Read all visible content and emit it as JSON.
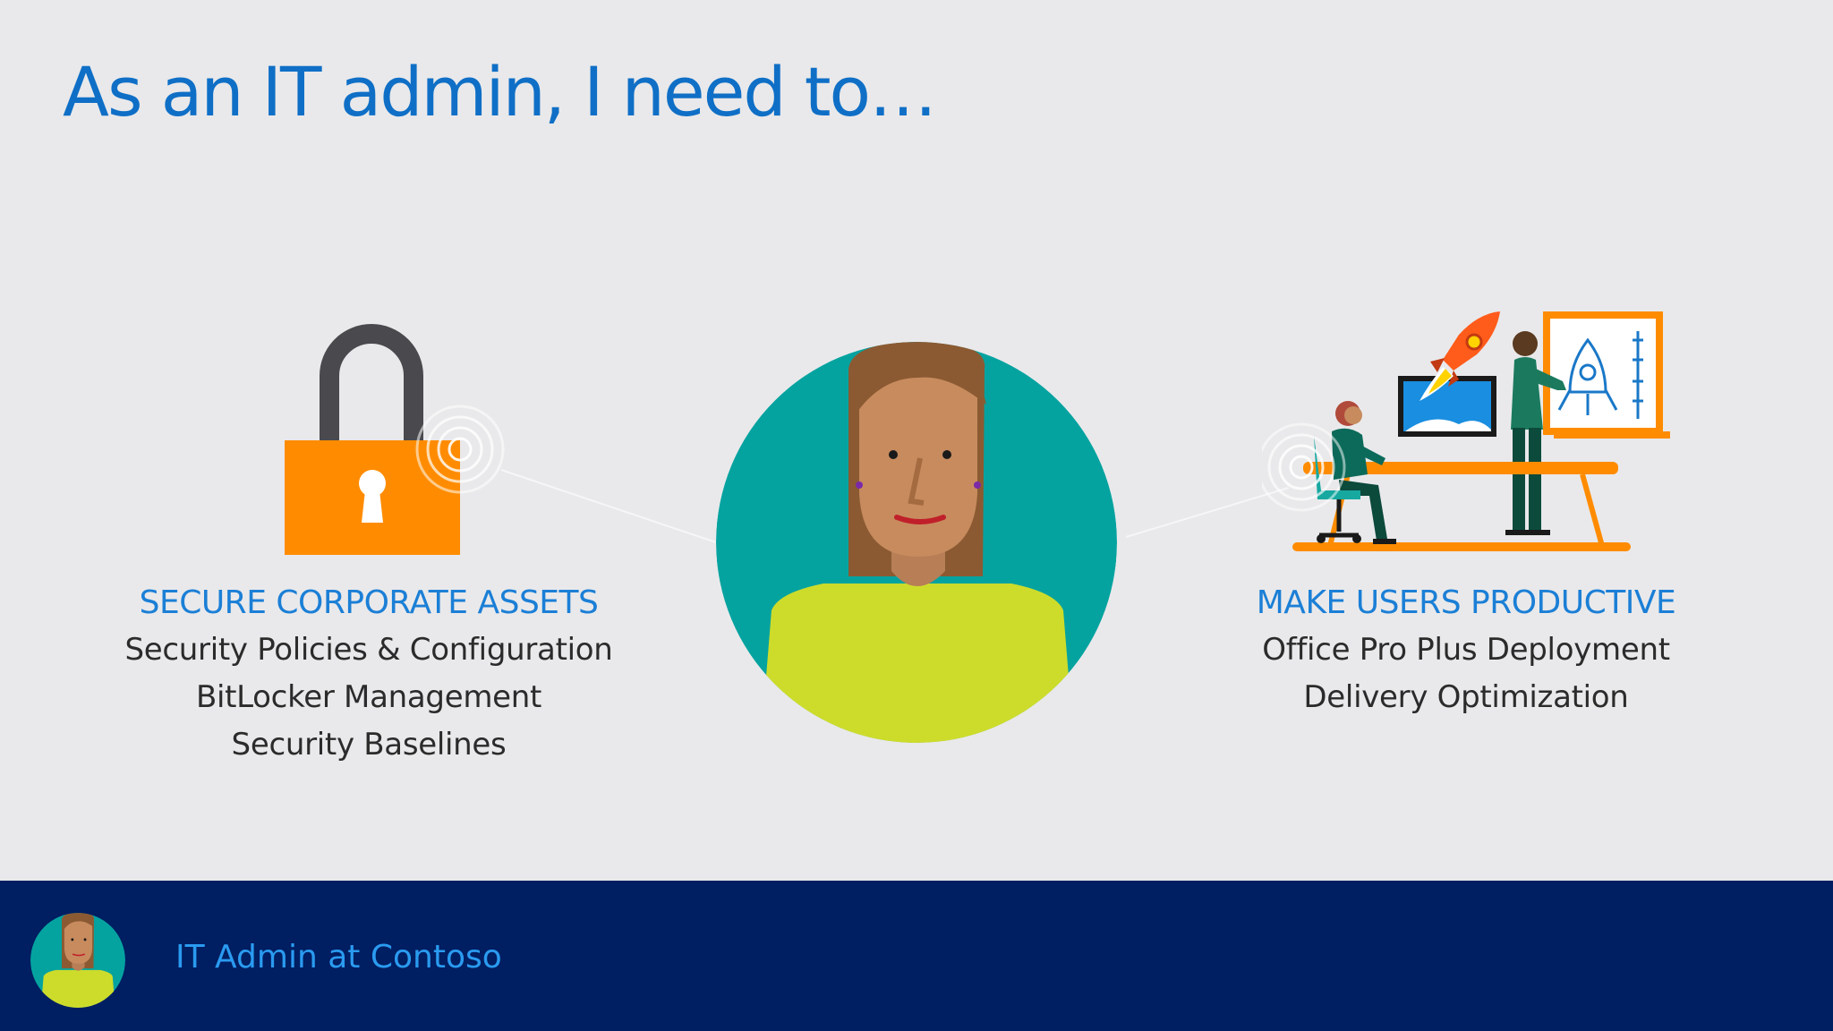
{
  "slide": {
    "title": "As an IT admin, I need to…",
    "left": {
      "heading": "SECURE CORPORATE ASSETS",
      "items": [
        "Security Policies & Configuration",
        "BitLocker Management",
        "Security Baselines"
      ],
      "icon": "padlock-icon"
    },
    "right": {
      "heading": "MAKE USERS PRODUCTIVE",
      "items": [
        "Office Pro Plus Deployment",
        "Delivery Optimization"
      ],
      "icon": "team-productivity-illustration"
    },
    "center": {
      "icon": "it-admin-avatar"
    }
  },
  "footer": {
    "label": "IT Admin at Contoso"
  },
  "colors": {
    "title_blue": "#0f6fc6",
    "heading_blue": "#1b7fd6",
    "footer_bg": "#001e62",
    "footer_text": "#2a9bf0",
    "avatar_teal": "#05a3a0",
    "shirt_yellow": "#cddc2b",
    "lock_orange": "#ff8c00"
  }
}
